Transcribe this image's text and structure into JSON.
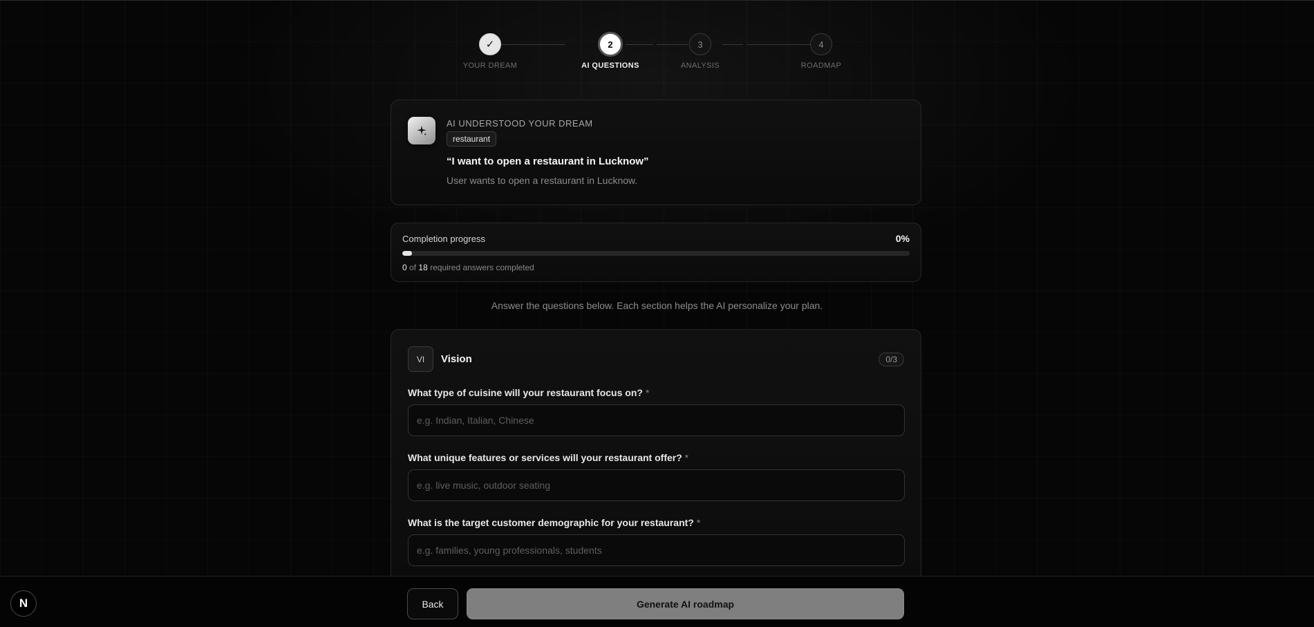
{
  "stepper": {
    "steps": [
      {
        "number": "✓",
        "label": "YOUR DREAM",
        "state": "done"
      },
      {
        "number": "2",
        "label": "AI QUESTIONS",
        "state": "active"
      },
      {
        "number": "3",
        "label": "ANALYSIS",
        "state": "pending"
      },
      {
        "number": "4",
        "label": "ROADMAP",
        "state": "pending"
      }
    ]
  },
  "dream": {
    "icon": "sparkle-icon",
    "heading": "AI UNDERSTOOD YOUR DREAM",
    "tag": "restaurant",
    "quote": "“I want to open a restaurant in Lucknow”",
    "summary": "User wants to open a restaurant in Lucknow."
  },
  "progress": {
    "title": "Completion progress",
    "percent_label": "0%",
    "percent_value": 0,
    "completed": "0",
    "of_text": "of",
    "total": "18",
    "suffix": "required answers completed"
  },
  "hint": "Answer the questions below. Each section helps the AI personalize your plan.",
  "section": {
    "badge": "VI",
    "title": "Vision",
    "count": "0/3",
    "questions": [
      {
        "label": "What type of cuisine will your restaurant focus on?",
        "required_mark": "*",
        "value": "",
        "placeholder": "e.g. Indian, Italian, Chinese"
      },
      {
        "label": "What unique features or services will your restaurant offer?",
        "required_mark": "*",
        "value": "",
        "placeholder": "e.g. live music, outdoor seating"
      },
      {
        "label": "What is the target customer demographic for your restaurant?",
        "required_mark": "*",
        "value": "",
        "placeholder": "e.g. families, young professionals, students"
      }
    ]
  },
  "footer": {
    "logo_letter": "N",
    "back_label": "Back",
    "generate_label": "Generate AI roadmap"
  },
  "colors": {
    "background": "#060606",
    "accent": "#ffffff",
    "button_disabled": "#7f7f7f"
  }
}
